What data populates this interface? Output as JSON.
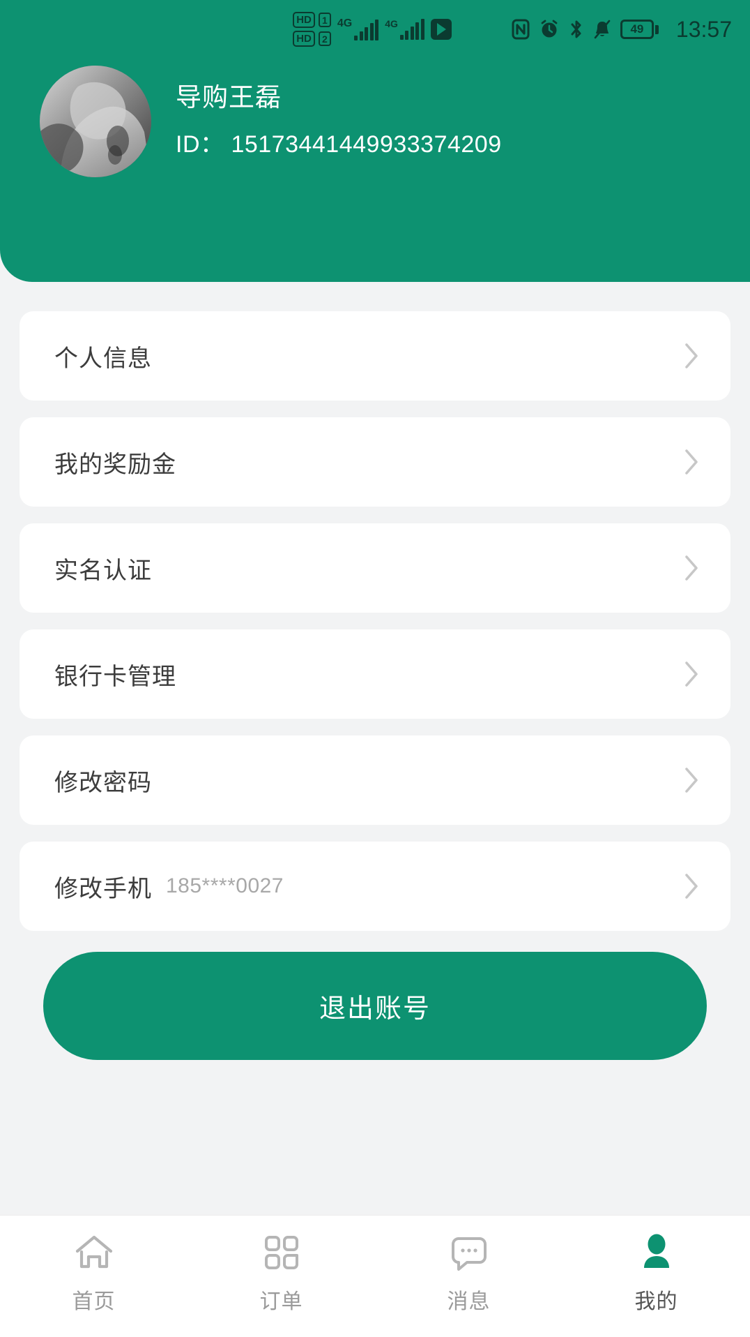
{
  "status_bar": {
    "hd_label_1": "HD",
    "hd_label_2": "HD",
    "sim1": "1",
    "sim2": "2",
    "net1": "4G",
    "net2": "4G",
    "battery_level": "49",
    "time": "13:57",
    "icons": [
      "nfc-icon",
      "alarm-icon",
      "bluetooth-icon",
      "bell-muted-icon",
      "battery-icon"
    ]
  },
  "profile": {
    "name": "导购王磊",
    "id_label": "ID：",
    "id_value": "15173441449933374209",
    "id_full": "ID： 15173441449933374209"
  },
  "menu": {
    "items": [
      {
        "label": "个人信息",
        "sub": ""
      },
      {
        "label": "我的奖励金",
        "sub": ""
      },
      {
        "label": "实名认证",
        "sub": ""
      },
      {
        "label": "银行卡管理",
        "sub": ""
      },
      {
        "label": "修改密码",
        "sub": ""
      },
      {
        "label": "修改手机",
        "sub": "185****0027"
      }
    ]
  },
  "logout": {
    "label": "退出账号"
  },
  "tabbar": {
    "items": [
      {
        "label": "首页",
        "icon": "home-icon",
        "active": false
      },
      {
        "label": "订单",
        "icon": "grid-icon",
        "active": false
      },
      {
        "label": "消息",
        "icon": "message-icon",
        "active": false
      },
      {
        "label": "我的",
        "icon": "person-icon",
        "active": true
      }
    ]
  },
  "colors": {
    "brand_green": "#0d9271",
    "page_bg": "#f2f3f4",
    "card_bg": "#ffffff",
    "text_primary": "#3c3c3c",
    "text_muted": "#a8a8a8",
    "status_dark": "#0b3b30"
  }
}
